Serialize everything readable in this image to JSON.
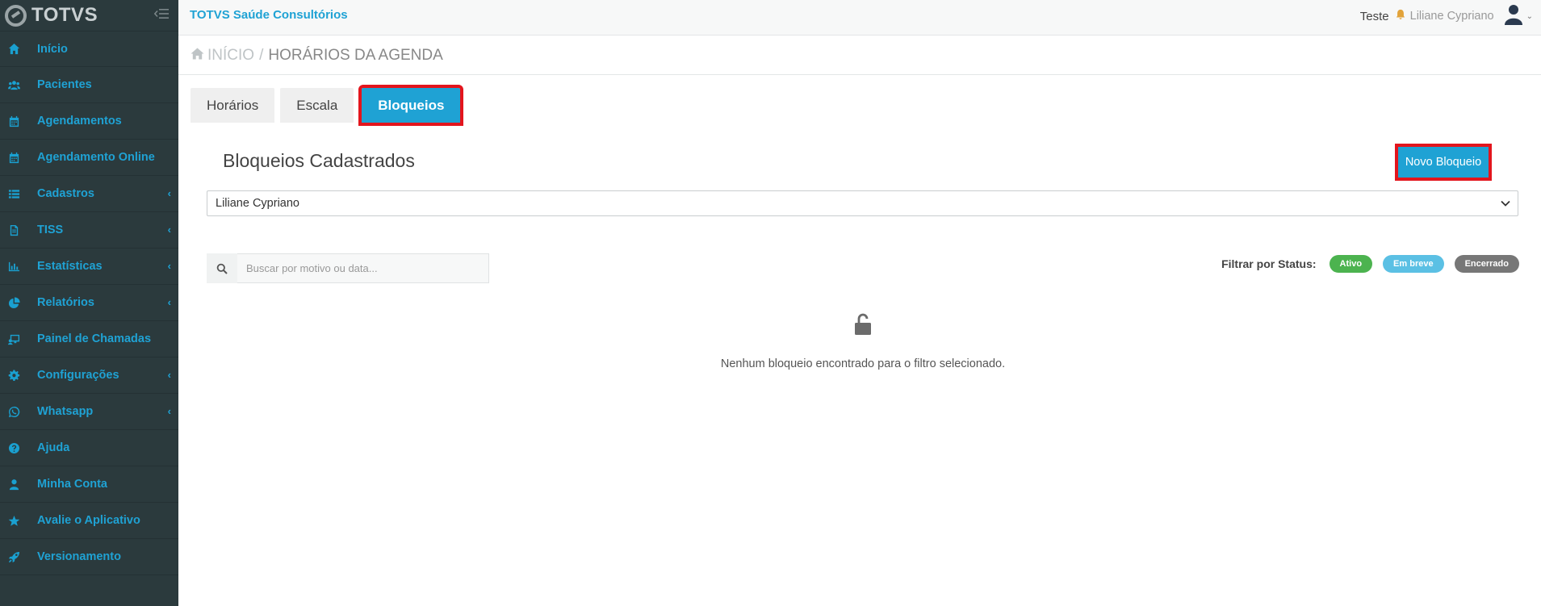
{
  "app": {
    "logo_text": "TOTVS",
    "org_name": "TOTVS Saúde Consultórios"
  },
  "topbar": {
    "teste": "Teste",
    "user_name": "Liliane Cypriano"
  },
  "sidebar": {
    "items": [
      {
        "label": "Início",
        "icon": "home-icon",
        "chevron": false
      },
      {
        "label": "Pacientes",
        "icon": "users-icon",
        "chevron": false
      },
      {
        "label": "Agendamentos",
        "icon": "calendar-icon",
        "chevron": false
      },
      {
        "label": "Agendamento Online",
        "icon": "calendar-icon",
        "chevron": false
      },
      {
        "label": "Cadastros",
        "icon": "list-icon",
        "chevron": true
      },
      {
        "label": "TISS",
        "icon": "file-icon",
        "chevron": true
      },
      {
        "label": "Estatísticas",
        "icon": "bar-chart-icon",
        "chevron": true
      },
      {
        "label": "Relatórios",
        "icon": "pie-chart-icon",
        "chevron": true
      },
      {
        "label": "Painel de Chamadas",
        "icon": "monitor-icon",
        "chevron": false
      },
      {
        "label": "Configurações",
        "icon": "gear-icon",
        "chevron": true
      },
      {
        "label": "Whatsapp",
        "icon": "whatsapp-icon",
        "chevron": true
      },
      {
        "label": "Ajuda",
        "icon": "question-icon",
        "chevron": false
      },
      {
        "label": "Minha Conta",
        "icon": "user-icon",
        "chevron": false
      },
      {
        "label": "Avalie o Aplicativo",
        "icon": "star-icon",
        "chevron": false
      },
      {
        "label": "Versionamento",
        "icon": "rocket-icon",
        "chevron": false
      }
    ]
  },
  "breadcrumb": {
    "home": "INÍCIO",
    "separator": "/",
    "current": "HORÁRIOS DA AGENDA"
  },
  "tabs": [
    {
      "label": "Horários",
      "active": false
    },
    {
      "label": "Escala",
      "active": false
    },
    {
      "label": "Bloqueios",
      "active": true
    }
  ],
  "main": {
    "title": "Bloqueios Cadastrados",
    "new_button": "Novo Bloqueio",
    "professional_select": "Liliane Cypriano",
    "search_placeholder": "Buscar por motivo ou data...",
    "filter_label": "Filtrar por Status:",
    "status_badges": [
      "Ativo",
      "Em breve",
      "Encerrado"
    ],
    "empty_message": "Nenhum bloqueio encontrado para o filtro selecionado."
  },
  "colors": {
    "sidebar_bg": "#2b3a3d",
    "accent": "#1fa2d4",
    "highlight": "#e3151d",
    "ativo": "#4cb34f",
    "em_breve": "#5bc0e4",
    "encerrado": "#777777"
  }
}
